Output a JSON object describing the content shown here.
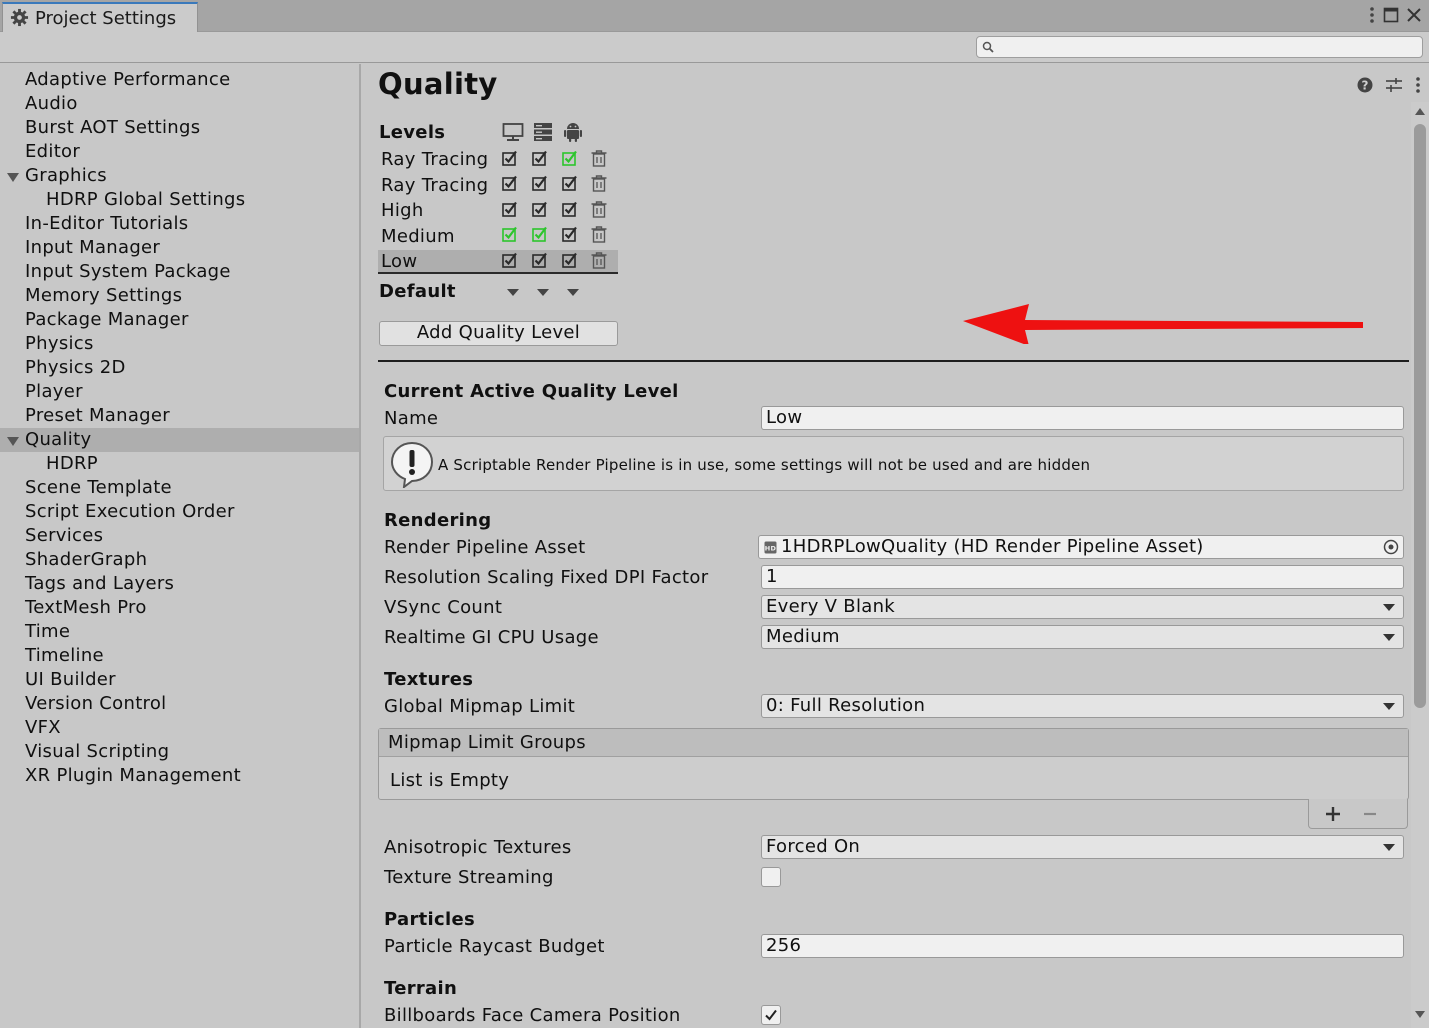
{
  "window": {
    "tab_title": "Project Settings",
    "tab_icon": "gear-icon",
    "controls": [
      "kebab-menu-icon",
      "maximize-icon",
      "close-icon"
    ]
  },
  "search": {
    "placeholder": "",
    "icon": "search-icon"
  },
  "sidebar": {
    "items": [
      {
        "label": "Adaptive Performance"
      },
      {
        "label": "Audio"
      },
      {
        "label": "Burst AOT Settings"
      },
      {
        "label": "Editor"
      },
      {
        "label": "Graphics",
        "expanded": true
      },
      {
        "label": "HDRP Global Settings",
        "child": true
      },
      {
        "label": "In-Editor Tutorials"
      },
      {
        "label": "Input Manager"
      },
      {
        "label": "Input System Package"
      },
      {
        "label": "Memory Settings"
      },
      {
        "label": "Package Manager"
      },
      {
        "label": "Physics"
      },
      {
        "label": "Physics 2D"
      },
      {
        "label": "Player"
      },
      {
        "label": "Preset Manager"
      },
      {
        "label": "Quality",
        "expanded": true,
        "selected": true
      },
      {
        "label": "HDRP",
        "child": true
      },
      {
        "label": "Scene Template"
      },
      {
        "label": "Script Execution Order"
      },
      {
        "label": "Services"
      },
      {
        "label": "ShaderGraph"
      },
      {
        "label": "Tags and Layers"
      },
      {
        "label": "TextMesh Pro"
      },
      {
        "label": "Time"
      },
      {
        "label": "Timeline"
      },
      {
        "label": "UI Builder"
      },
      {
        "label": "Version Control"
      },
      {
        "label": "VFX"
      },
      {
        "label": "Visual Scripting"
      },
      {
        "label": "XR Plugin Management"
      }
    ]
  },
  "main": {
    "title": "Quality",
    "header_icons": [
      "help-icon",
      "preset-settings-icon",
      "kebab-menu-icon"
    ],
    "levels": {
      "label": "Levels",
      "platform_icons": [
        "standalone-monitor-icon",
        "server-icon",
        "android-icon"
      ],
      "rows": [
        {
          "name": "Ray Tracing (",
          "checks": [
            true,
            true,
            true
          ],
          "default_col": 2
        },
        {
          "name": "Ray Tracing",
          "checks": [
            true,
            true,
            true
          ],
          "default_col": -1
        },
        {
          "name": "High",
          "checks": [
            true,
            true,
            true
          ],
          "default_col": -1
        },
        {
          "name": "Medium",
          "checks": [
            true,
            true,
            true
          ],
          "default_cols": [
            0,
            1
          ]
        },
        {
          "name": "Low",
          "checks": [
            true,
            true,
            true
          ],
          "selected": true
        }
      ],
      "default_label": "Default",
      "add_button": "Add Quality Level"
    },
    "current": {
      "section": "Current Active Quality Level",
      "name_label": "Name",
      "name_value": "Low",
      "help_text": "A Scriptable Render Pipeline is in use, some settings will not be used and are hidden"
    },
    "rendering": {
      "section": "Rendering",
      "rpa_label": "Render Pipeline Asset",
      "rpa_value": "1HDRPLowQuality (HD Render Pipeline Asset)",
      "rpa_icon": "hd-asset-icon",
      "dpi_label": "Resolution Scaling Fixed DPI Factor",
      "dpi_value": "1",
      "vsync_label": "VSync Count",
      "vsync_value": "Every V Blank",
      "gi_label": "Realtime GI CPU Usage",
      "gi_value": "Medium"
    },
    "textures": {
      "section": "Textures",
      "mip_label": "Global Mipmap Limit",
      "mip_value": "0: Full Resolution",
      "groups_header": "Mipmap Limit Groups",
      "groups_empty": "List is Empty",
      "aniso_label": "Anisotropic Textures",
      "aniso_value": "Forced On",
      "streaming_label": "Texture Streaming",
      "streaming_checked": false
    },
    "particles": {
      "section": "Particles",
      "raycast_label": "Particle Raycast Budget",
      "raycast_value": "256"
    },
    "terrain": {
      "section": "Terrain",
      "billboard_label": "Billboards Face Camera Position",
      "billboard_checked": true
    }
  },
  "colors": {
    "default_check_green": "#2cc52c",
    "annotation_arrow": "#ee1111",
    "accent": "#3a79bb"
  }
}
